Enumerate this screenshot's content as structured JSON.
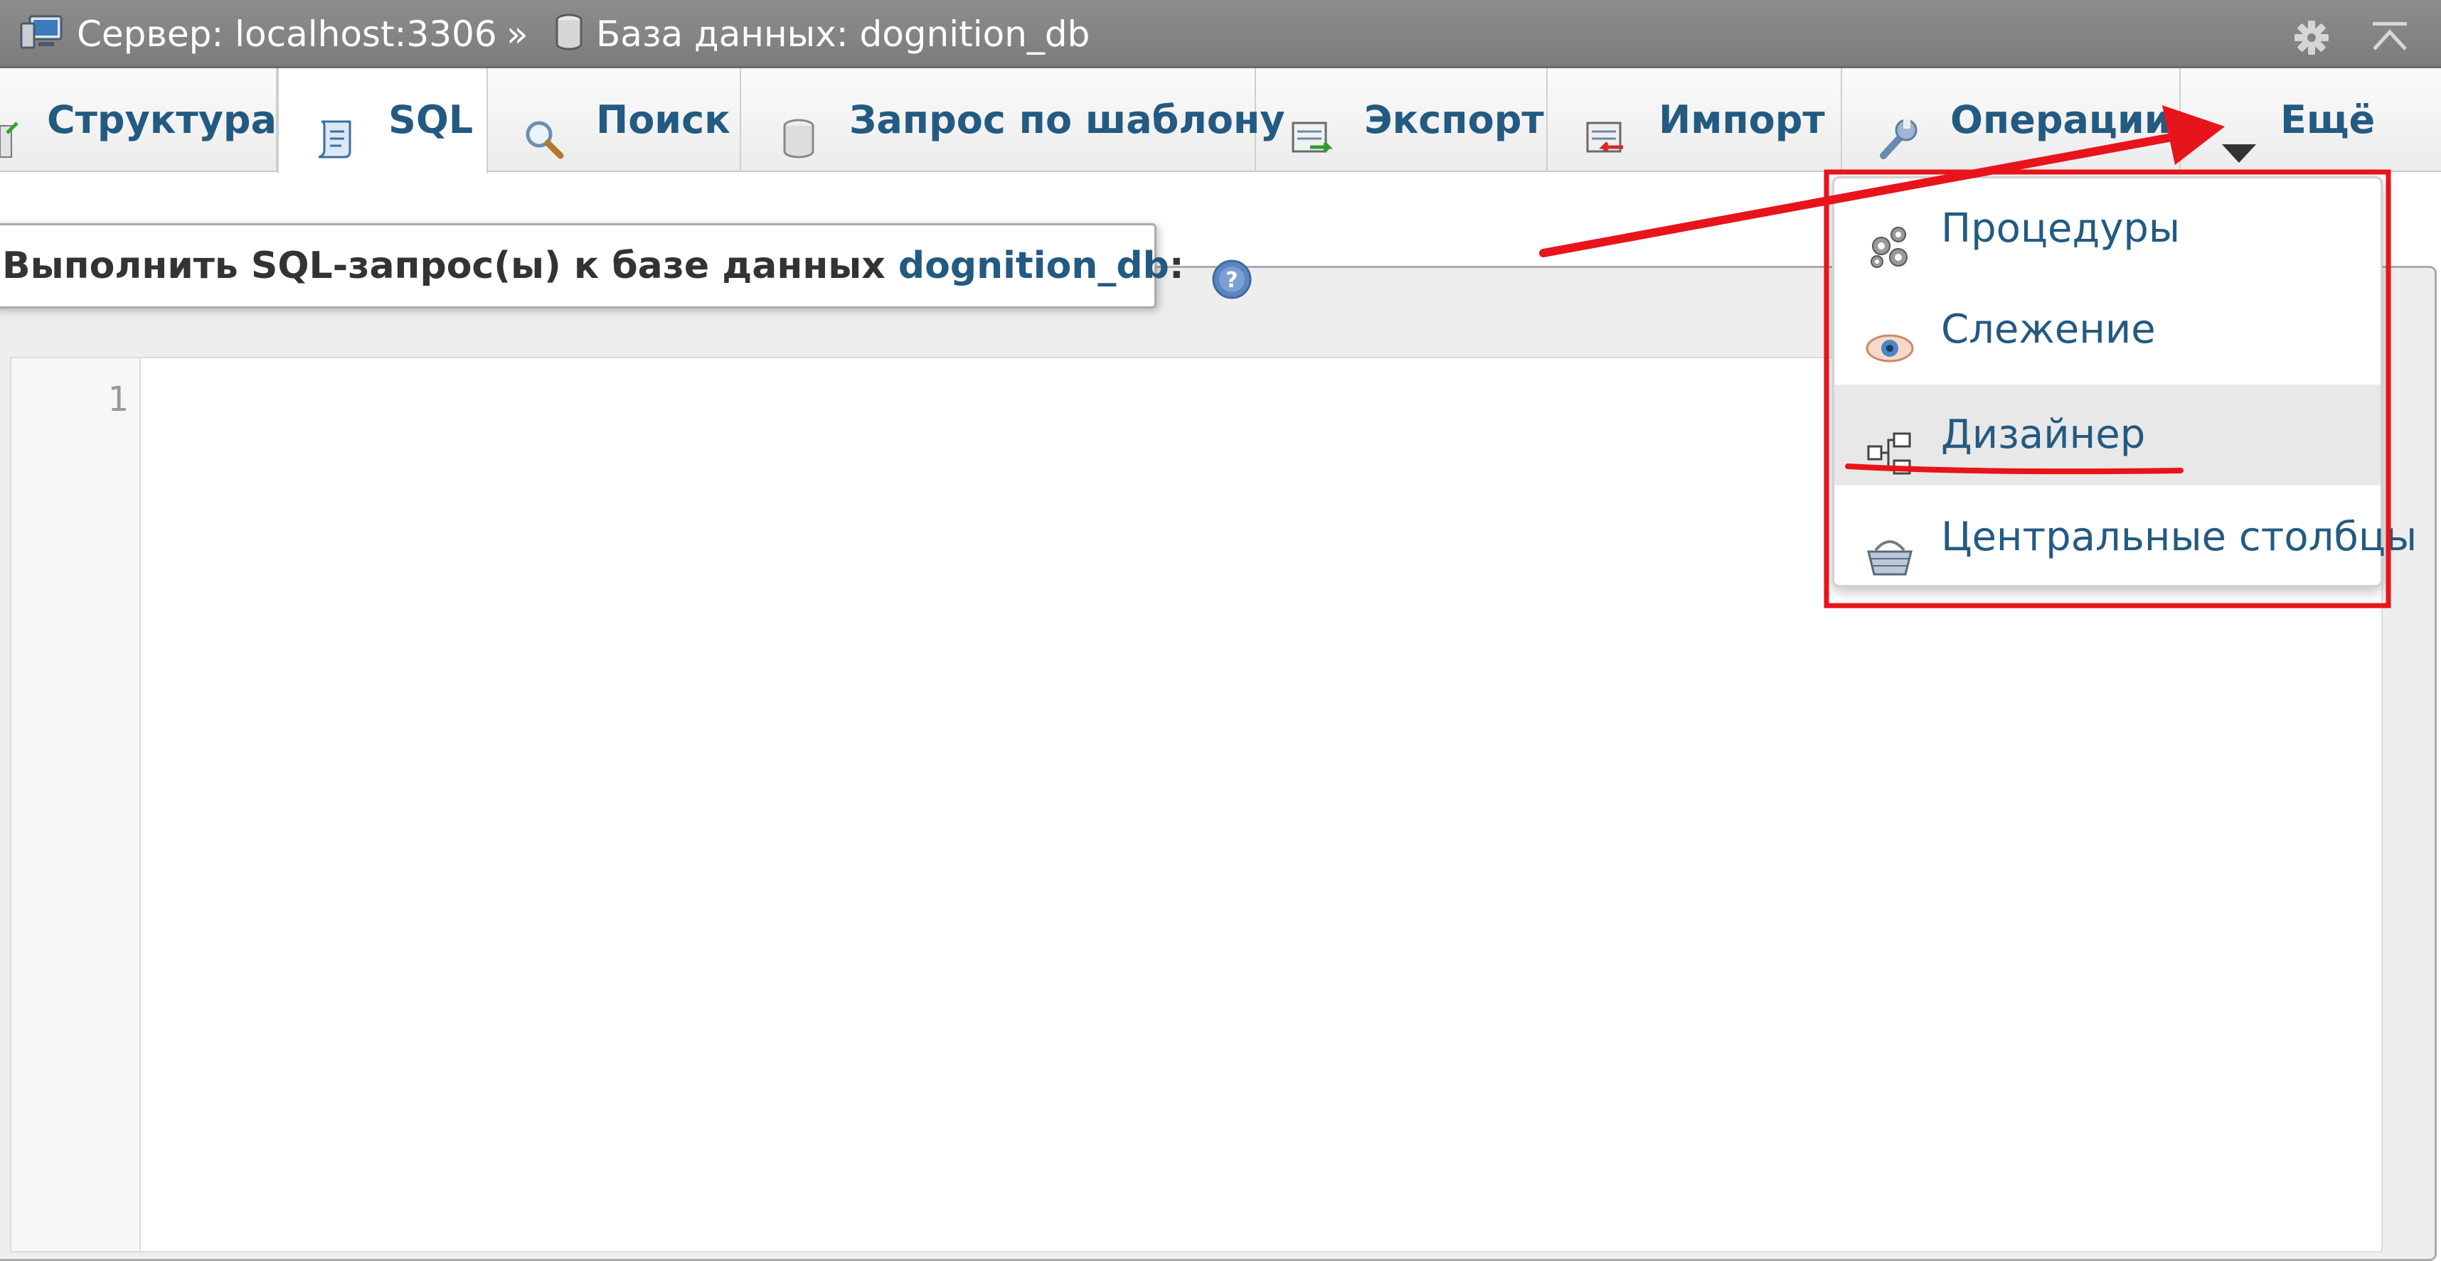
{
  "breadcrumb": {
    "server": "Сервер: localhost:3306",
    "separator": "»",
    "database": "База данных: dognition_db"
  },
  "tabs": [
    {
      "label": "Структура",
      "icon": "structure-icon"
    },
    {
      "label": "SQL",
      "icon": "sql-icon",
      "active": true
    },
    {
      "label": "Поиск",
      "icon": "search-icon"
    },
    {
      "label": "Запрос по шаблону",
      "icon": "query-icon"
    },
    {
      "label": "Экспорт",
      "icon": "export-icon"
    },
    {
      "label": "Импорт",
      "icon": "import-icon"
    },
    {
      "label": "Операции",
      "icon": "wrench-icon"
    },
    {
      "label": "Ещё",
      "icon": "triangle-down-icon"
    }
  ],
  "sql_panel": {
    "legend_prefix": "Выполнить SQL-запрос(ы) к базе данных",
    "legend_db": "dognition_db",
    "legend_suffix": ":",
    "line_number": "1"
  },
  "more_menu": {
    "items": [
      {
        "label": "Процедуры",
        "icon": "routines-icon"
      },
      {
        "label": "Слежение",
        "icon": "eye-icon"
      },
      {
        "label": "Дизайнер",
        "icon": "designer-icon",
        "highlighted": true
      },
      {
        "label": "Центральные столбцы",
        "icon": "basket-icon"
      }
    ]
  },
  "colors": {
    "link": "#235a81",
    "annotation": "#e8141b",
    "topbar": "#888888"
  }
}
